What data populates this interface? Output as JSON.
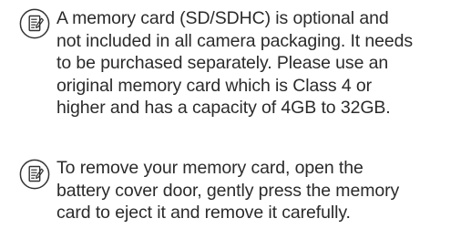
{
  "notes": [
    {
      "icon": "note-pad-icon",
      "lines": [
        "A memory card (SD/SDHC) is optional and",
        "not included in all camera packaging. It needs",
        "to be purchased separately. Please use an",
        "original memory card which is Class 4 or",
        "higher and has a capacity of 4GB to 32GB."
      ]
    },
    {
      "icon": "note-pad-icon",
      "lines": [
        "To remove your memory card, open the",
        "battery cover door, gently press the memory",
        "card to eject it and remove it carefully."
      ]
    }
  ],
  "colors": {
    "text": "#2b2b2b",
    "icon": "#333333"
  }
}
